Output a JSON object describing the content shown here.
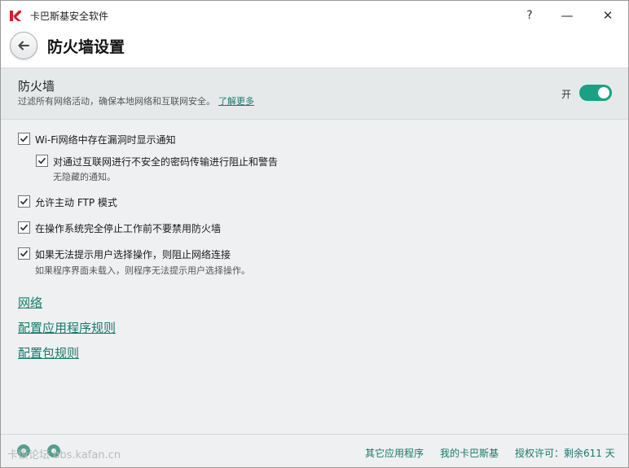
{
  "window": {
    "title": "卡巴斯基安全软件",
    "help_label": "?",
    "minimize_label": "—",
    "close_label": "✕"
  },
  "header": {
    "title": "防火墙设置"
  },
  "firewall": {
    "title": "防火墙",
    "description": "过滤所有网络活动，确保本地网络和互联网安全。",
    "learn_more": "了解更多",
    "toggle_label": "开",
    "enabled": true
  },
  "options": [
    {
      "label": "Wi-Fi网络中存在漏洞时显示通知",
      "checked": true
    },
    {
      "label": "对通过互联网进行不安全的密码传输进行阻止和警告",
      "checked": true,
      "note": "无隐藏的通知。"
    },
    {
      "label": "允许主动 FTP 模式",
      "checked": true
    },
    {
      "label": "在操作系统完全停止工作前不要禁用防火墙",
      "checked": true
    },
    {
      "label": "如果无法提示用户选择操作，则阻止网络连接",
      "checked": true,
      "note": "如果程序界面未载入，则程序无法提示用户选择操作。"
    }
  ],
  "links": {
    "network": "网络",
    "app_rules": "配置应用程序规则",
    "packet_rules": "配置包规则"
  },
  "footer": {
    "watermark": "卡饭论坛 bbs.kafan.cn",
    "other_apps": "其它应用程序",
    "my_kaspersky": "我的卡巴斯基",
    "license": "授权许可：剩余611 天"
  },
  "colors": {
    "accent": "#177a6a",
    "toggle_on": "#1aa084",
    "logo_red": "#d31f26"
  }
}
